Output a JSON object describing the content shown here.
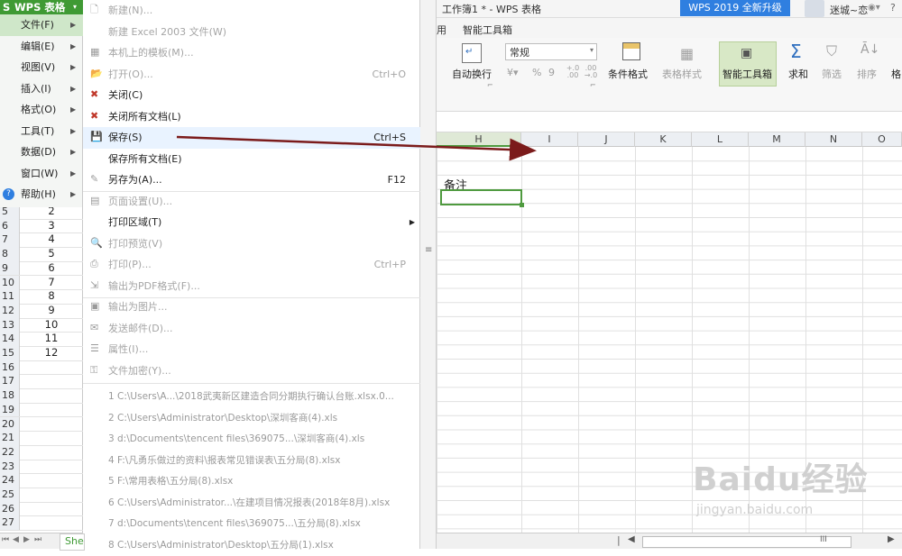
{
  "app": {
    "brand": "WPS 表格",
    "window_title": "工作簿1 * - WPS 表格",
    "upgrade_button": "WPS 2019 全新升级",
    "user_name": "迷城~恋"
  },
  "main_menu": [
    {
      "label": "文件(F)",
      "selected": true
    },
    {
      "label": "编辑(E)"
    },
    {
      "label": "视图(V)"
    },
    {
      "label": "插入(I)"
    },
    {
      "label": "格式(O)"
    },
    {
      "label": "工具(T)"
    },
    {
      "label": "数据(D)"
    },
    {
      "label": "窗口(W)"
    },
    {
      "label": "帮助(H)"
    }
  ],
  "file_menu": {
    "items": [
      {
        "label": "新建(N)...",
        "shortcut": "",
        "enabled": false,
        "icon": "new-file-icon"
      },
      {
        "label": "新建 Excel 2003 文件(W)",
        "shortcut": "",
        "enabled": false,
        "icon": ""
      },
      {
        "label": "本机上的模板(M)...",
        "shortcut": "",
        "enabled": false,
        "icon": "template-icon"
      },
      {
        "label": "打开(O)...",
        "shortcut": "Ctrl+O",
        "enabled": false,
        "icon": "open-folder-icon"
      },
      {
        "label": "关闭(C)",
        "shortcut": "",
        "enabled": true,
        "icon": "close-doc-icon"
      },
      {
        "label": "关闭所有文档(L)",
        "shortcut": "",
        "enabled": true,
        "icon": "close-all-icon"
      },
      {
        "label": "保存(S)",
        "shortcut": "Ctrl+S",
        "enabled": true,
        "icon": "save-icon"
      },
      {
        "label": "保存所有文档(E)",
        "shortcut": "",
        "enabled": true,
        "icon": ""
      },
      {
        "label": "另存为(A)...",
        "shortcut": "F12",
        "enabled": true,
        "icon": "save-as-icon"
      },
      {
        "label": "页面设置(U)...",
        "shortcut": "",
        "enabled": false,
        "icon": "page-setup-icon"
      },
      {
        "label": "打印区域(T)",
        "shortcut": "",
        "enabled": true,
        "icon": "",
        "submenu": true
      },
      {
        "label": "打印预览(V)",
        "shortcut": "",
        "enabled": false,
        "icon": "print-preview-icon"
      },
      {
        "label": "打印(P)...",
        "shortcut": "Ctrl+P",
        "enabled": false,
        "icon": "print-icon"
      },
      {
        "label": "输出为PDF格式(F)...",
        "shortcut": "",
        "enabled": false,
        "icon": "pdf-icon"
      },
      {
        "label": "输出为图片...",
        "shortcut": "",
        "enabled": false,
        "icon": "image-export-icon"
      },
      {
        "label": "发送邮件(D)...",
        "shortcut": "",
        "enabled": false,
        "icon": "mail-icon"
      },
      {
        "label": "属性(I)...",
        "shortcut": "",
        "enabled": false,
        "icon": "properties-icon"
      },
      {
        "label": "文件加密(Y)...",
        "shortcut": "",
        "enabled": false,
        "icon": "encrypt-icon"
      }
    ],
    "recent": [
      "1 C:\\Users\\A...\\2018武夷新区建造合同分期执行确认台账.xlsx.0...",
      "2 C:\\Users\\Administrator\\Desktop\\深圳客商(4).xls",
      "3 d:\\Documents\\tencent files\\369075...\\深圳客商(4).xls",
      "4 F:\\凡勇乐做过的资料\\报表常见错误表\\五分局(8).xlsx",
      "5 F:\\常用表格\\五分局(8).xlsx",
      "6 C:\\Users\\Administrator...\\在建项目情况报表(2018年8月).xlsx",
      "7 d:\\Documents\\tencent files\\369075...\\五分局(8).xlsx",
      "8 C:\\Users\\Administrator\\Desktop\\五分局(1).xlsx"
    ]
  },
  "ribbon": {
    "tabs": [
      "用",
      "智能工具箱"
    ],
    "number_format": "常规",
    "wrap_text": "自动换行",
    "percent": "%",
    "thousands": "9",
    "dec_inc": "+.0 .00",
    "dec_dec": ".00 →.0",
    "conditional_format": "条件格式",
    "table_style": "表格样式",
    "smart_toolbox": "智能工具箱",
    "sum": "求和",
    "filter": "筛选",
    "sort": "排序",
    "format": "格"
  },
  "sheet": {
    "columns": [
      "H",
      "I",
      "J",
      "K",
      "L",
      "M",
      "N",
      "O"
    ],
    "rows": [
      {
        "n": "5",
        "v": "2"
      },
      {
        "n": "6",
        "v": "3"
      },
      {
        "n": "7",
        "v": "4"
      },
      {
        "n": "8",
        "v": "5"
      },
      {
        "n": "9",
        "v": "6"
      },
      {
        "n": "10",
        "v": "7"
      },
      {
        "n": "11",
        "v": "8"
      },
      {
        "n": "12",
        "v": "9"
      },
      {
        "n": "13",
        "v": "10"
      },
      {
        "n": "14",
        "v": "11"
      },
      {
        "n": "15",
        "v": "12"
      },
      {
        "n": "16",
        "v": ""
      },
      {
        "n": "17",
        "v": ""
      },
      {
        "n": "18",
        "v": ""
      },
      {
        "n": "19",
        "v": ""
      },
      {
        "n": "20",
        "v": ""
      },
      {
        "n": "21",
        "v": ""
      },
      {
        "n": "22",
        "v": ""
      },
      {
        "n": "23",
        "v": ""
      },
      {
        "n": "24",
        "v": ""
      },
      {
        "n": "25",
        "v": ""
      },
      {
        "n": "26",
        "v": ""
      },
      {
        "n": "27",
        "v": ""
      }
    ],
    "note_cell": "备注",
    "sheet_tab": "She",
    "hscroll_mark": "III"
  },
  "watermark": {
    "main": "Baidu经验",
    "url": "jingyan.baidu.com"
  },
  "colors": {
    "brand_green": "#3f9a34",
    "arrow": "#7b1b1b",
    "selection": "#4f9a3f"
  }
}
